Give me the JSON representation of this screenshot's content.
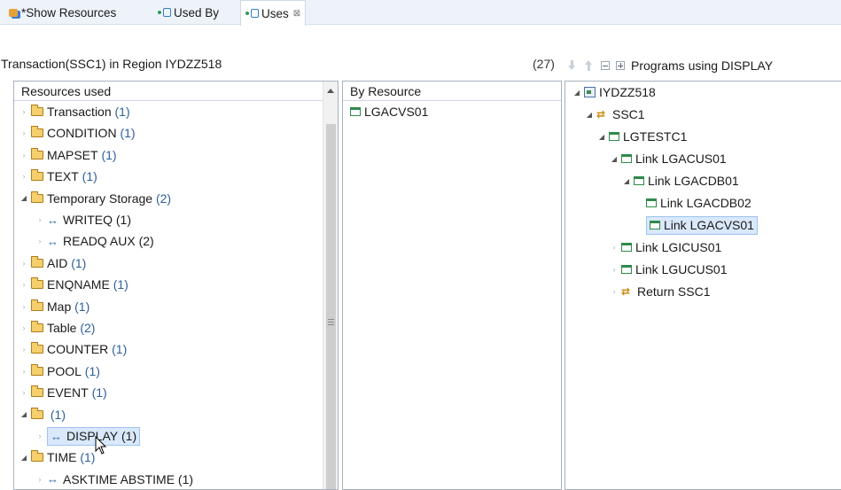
{
  "tabs": [
    {
      "label": "*Show Resources",
      "icon": "resources-icon",
      "active": false
    },
    {
      "label": "Used By",
      "icon": "used-by-icon",
      "active": false
    },
    {
      "label": "Uses",
      "icon": "uses-icon",
      "active": true,
      "close": "⊠"
    }
  ],
  "header": {
    "title": "Transaction(SSC1) in Region IYDZZ518",
    "count": "(27)",
    "right_title": "Programs using DISPLAY"
  },
  "resources": {
    "heading": "Resources used",
    "items": [
      {
        "label": "Transaction",
        "count": "(1)",
        "level": 0,
        "kind": "folder",
        "open": false
      },
      {
        "label": "CONDITION",
        "count": "(1)",
        "level": 0,
        "kind": "folder",
        "open": false
      },
      {
        "label": "MAPSET",
        "count": "(1)",
        "level": 0,
        "kind": "folder",
        "open": false
      },
      {
        "label": "TEXT",
        "count": "(1)",
        "level": 0,
        "kind": "folder",
        "open": false
      },
      {
        "label": "Temporary Storage",
        "count": "(2)",
        "level": 0,
        "kind": "folder",
        "open": true
      },
      {
        "label": "WRITEQ",
        "count": "(1)",
        "level": 1,
        "kind": "arrow",
        "open": false
      },
      {
        "label": "READQ AUX",
        "count": "(2)",
        "level": 1,
        "kind": "arrow",
        "open": false
      },
      {
        "label": "AID",
        "count": "(1)",
        "level": 0,
        "kind": "folder",
        "open": false
      },
      {
        "label": "ENQNAME",
        "count": "(1)",
        "level": 0,
        "kind": "folder",
        "open": false
      },
      {
        "label": "Map",
        "count": "(1)",
        "level": 0,
        "kind": "folder",
        "open": false
      },
      {
        "label": "Table",
        "count": "(2)",
        "level": 0,
        "kind": "folder",
        "open": false
      },
      {
        "label": "COUNTER",
        "count": "(1)",
        "level": 0,
        "kind": "folder",
        "open": false
      },
      {
        "label": "POOL",
        "count": "(1)",
        "level": 0,
        "kind": "folder",
        "open": false
      },
      {
        "label": "EVENT",
        "count": "(1)",
        "level": 0,
        "kind": "folder",
        "open": false
      },
      {
        "label": "",
        "count": "(1)",
        "level": 0,
        "kind": "folder",
        "open": true
      },
      {
        "label": "DISPLAY",
        "count": "(1)",
        "level": 1,
        "kind": "arrow",
        "open": false,
        "selected": true
      },
      {
        "label": "TIME",
        "count": "(1)",
        "level": 0,
        "kind": "folder",
        "open": true
      },
      {
        "label": "ASKTIME ABSTIME",
        "count": "(1)",
        "level": 1,
        "kind": "arrow",
        "open": false
      }
    ]
  },
  "by_resource": {
    "heading": "By Resource",
    "items": [
      {
        "label": "LGACVS01"
      }
    ]
  },
  "programs": {
    "items": [
      {
        "label": "IYDZZ518",
        "level": 0,
        "kind": "region",
        "open": true
      },
      {
        "label": "SSC1",
        "level": 1,
        "kind": "transaction",
        "open": true
      },
      {
        "label": "LGTESTC1",
        "level": 2,
        "kind": "program",
        "open": true
      },
      {
        "label": "Link LGACUS01",
        "level": 3,
        "kind": "program",
        "open": true
      },
      {
        "label": "Link LGACDB01",
        "level": 4,
        "kind": "program",
        "open": true
      },
      {
        "label": "Link LGACDB02",
        "level": 5,
        "kind": "program",
        "open": null
      },
      {
        "label": "Link LGACVS01",
        "level": 5,
        "kind": "program",
        "open": null,
        "selected": true
      },
      {
        "label": "Link LGICUS01",
        "level": 3,
        "kind": "program",
        "open": false
      },
      {
        "label": "Link LGUCUS01",
        "level": 3,
        "kind": "program",
        "open": false
      },
      {
        "label": "Return SSC1",
        "level": 3,
        "kind": "transaction",
        "open": false
      }
    ]
  }
}
